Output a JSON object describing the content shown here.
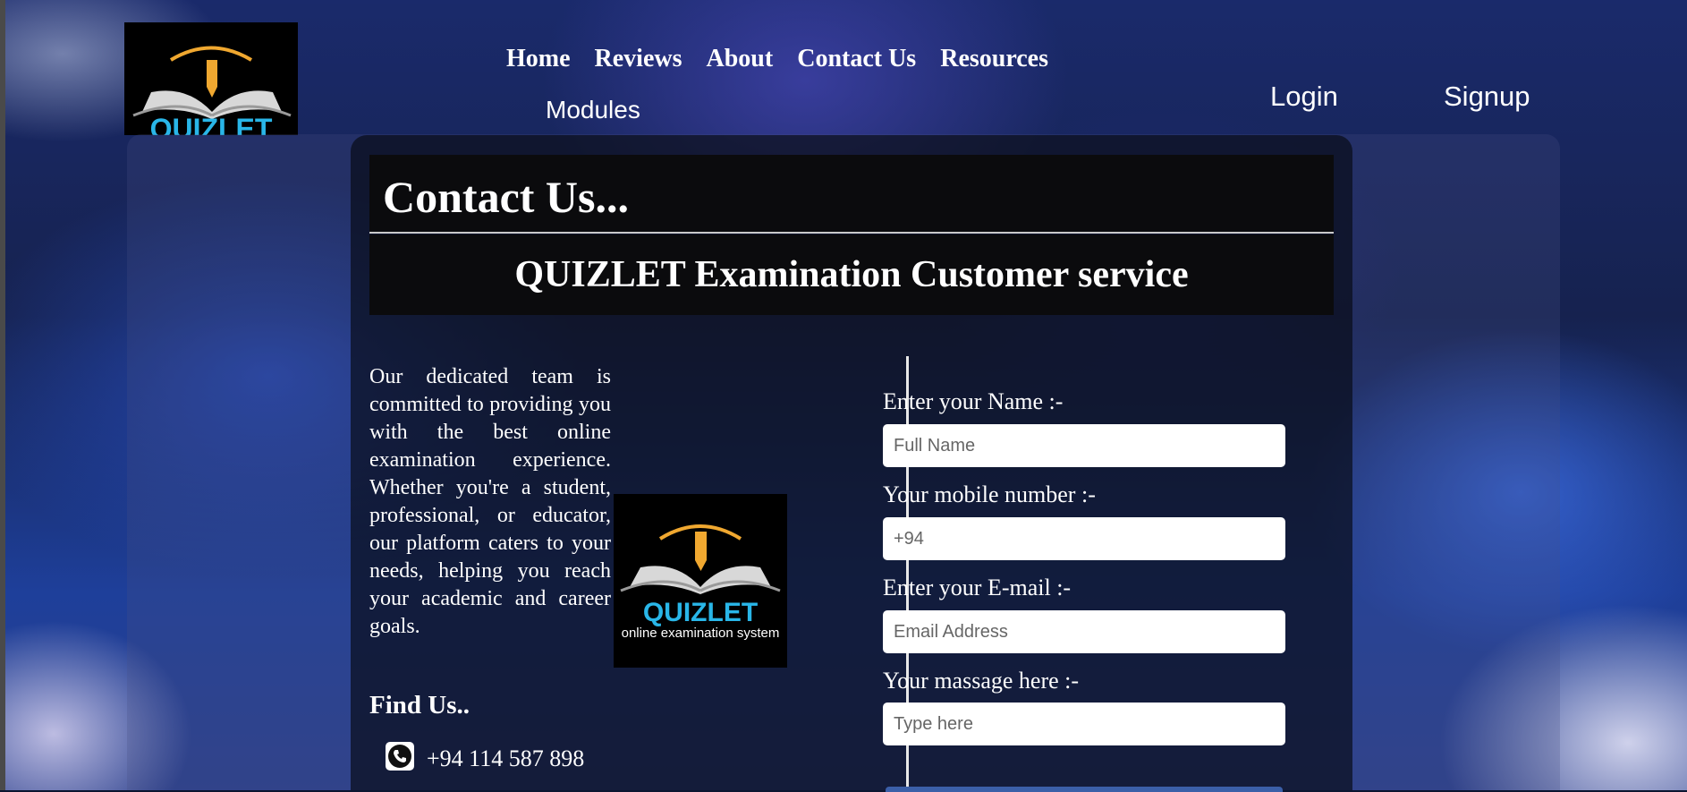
{
  "nav": {
    "items": [
      "Home",
      "Reviews",
      "About",
      "Contact Us",
      "Resources"
    ],
    "modules": "Modules",
    "login": "Login",
    "signup": "Signup"
  },
  "logo": {
    "wordmark": "QUIZLET",
    "tagline": "online examination system"
  },
  "page": {
    "title": "Contact Us...",
    "subtitle": "QUIZLET Examination Customer service",
    "description": "Our dedicated team is committed to providing you with the best online examination experience. Whether you're a student, professional, or educator, our platform caters to your needs, helping you reach your academic and career goals.",
    "find_us": "Find Us..",
    "phone": "+94 114 587 898"
  },
  "form": {
    "name_label": "Enter your Name :-",
    "name_placeholder": "Full Name",
    "mobile_label": "Your mobile number :-",
    "mobile_placeholder": "+94",
    "email_label": "Enter your E-mail :-",
    "email_placeholder": "Email Address",
    "message_label": "Your massage here :-",
    "message_placeholder": "Type here"
  },
  "colors": {
    "logo_cyan": "#29b6e8",
    "logo_gold": "#f0a830"
  }
}
